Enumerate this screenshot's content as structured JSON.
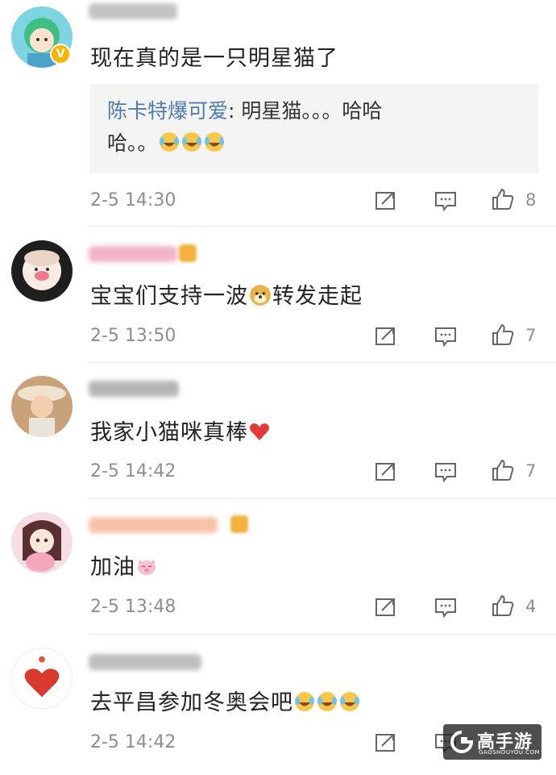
{
  "comments": [
    {
      "text": "现在真的是一只明星猫了",
      "verified_badge": "V",
      "quote": {
        "name": "陈卡特爆可爱",
        "sep": ":",
        "text1": " 明星猫。。。哈哈",
        "text2": "哈。。"
      },
      "time": "2-5 14:30",
      "likes": "8"
    },
    {
      "text_before": "宝宝们支持一波",
      "text_after": "转发走起",
      "time": "2-5 13:50",
      "likes": "7"
    },
    {
      "text": "我家小猫咪真棒",
      "time": "2-5 14:42",
      "likes": "7"
    },
    {
      "text": "加油",
      "time": "2-5 13:48",
      "likes": "4"
    },
    {
      "text": "去平昌参加冬奥会吧",
      "time": "2-5 14:42",
      "likes": ""
    }
  ],
  "icons": {
    "repost": "repost-icon",
    "comment": "comment-icon",
    "like": "like-icon"
  },
  "colors": {
    "quote_name": "#4d7bb0",
    "meta": "#8e8e8e",
    "verified": "#f7b500"
  },
  "watermark": {
    "title": "高手游",
    "sub": "GAOSHOUYOU.COM"
  }
}
